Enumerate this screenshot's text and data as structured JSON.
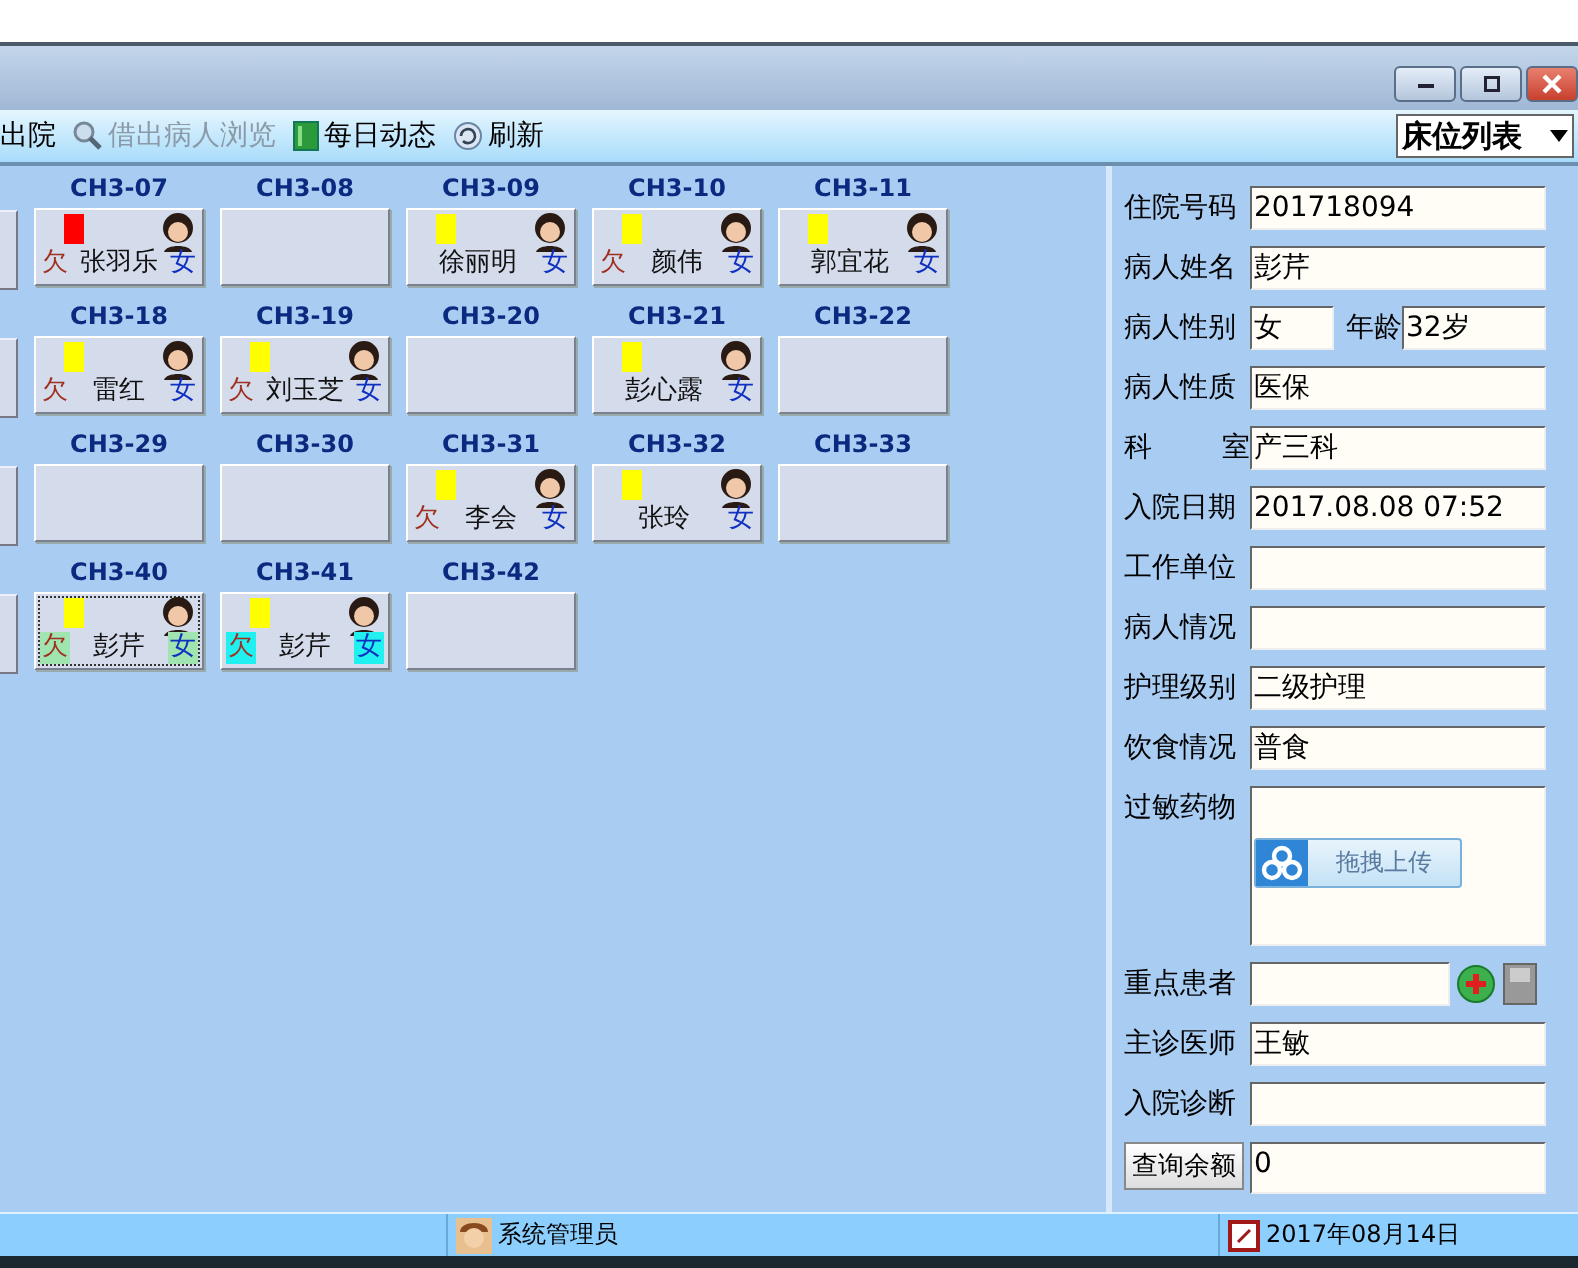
{
  "toolbar": {
    "items": [
      {
        "label": "出院",
        "disabled": false,
        "kind": "none"
      },
      {
        "label": "借出病人浏览",
        "disabled": true,
        "kind": "search"
      },
      {
        "label": "每日动态",
        "disabled": false,
        "kind": "book"
      },
      {
        "label": "刷新",
        "disabled": false,
        "kind": "refresh"
      }
    ],
    "view_select": "床位列表"
  },
  "bed_rows": [
    [
      {
        "bed": "CH3-07",
        "color": "#ff0000",
        "owing_mark": "欠",
        "name": "张羽乐",
        "sex": "女",
        "focused": false
      },
      {
        "bed": "CH3-08"
      },
      {
        "bed": "CH3-09",
        "color": "#ffff00",
        "name": "徐丽明",
        "sex": "女",
        "focused": false
      },
      {
        "bed": "CH3-10",
        "color": "#ffff00",
        "owing_mark": "欠",
        "name": "颜伟",
        "sex": "女",
        "focused": false
      },
      {
        "bed": "CH3-11",
        "color": "#ffff00",
        "name": "郭宜花",
        "sex": "女",
        "focused": false
      }
    ],
    [
      {
        "bed": "CH3-18",
        "color": "#ffff00",
        "owing_mark": "欠",
        "name": "雷红",
        "sex": "女",
        "focused": false
      },
      {
        "bed": "CH3-19",
        "color": "#ffff00",
        "owing_mark": "欠",
        "name": "刘玉芝",
        "sex": "女",
        "focused": false
      },
      {
        "bed": "CH3-20"
      },
      {
        "bed": "CH3-21",
        "color": "#ffff00",
        "name": "彭心露",
        "sex": "女",
        "focused": false
      },
      {
        "bed": "CH3-22"
      }
    ],
    [
      {
        "bed": "CH3-29"
      },
      {
        "bed": "CH3-30"
      },
      {
        "bed": "CH3-31",
        "color": "#ffff00",
        "owing_mark": "欠",
        "name": "李会",
        "sex": "女",
        "focused": false
      },
      {
        "bed": "CH3-32",
        "color": "#ffff00",
        "name": "张玲",
        "sex": "女",
        "focused": false
      },
      {
        "bed": "CH3-33"
      }
    ],
    [
      {
        "bed": "CH3-40",
        "color": "#ffff00",
        "owing_mark": "欠",
        "name": "彭芹",
        "sex": "女",
        "focused": true,
        "tag": {
          "color": "#a0e4b0"
        }
      },
      {
        "bed": "CH3-41",
        "color": "#ffff00",
        "owing_mark": "欠",
        "name": "彭芹",
        "sex": "女",
        "focused": false,
        "tag": {
          "color": "#20f0f0"
        }
      },
      {
        "bed": "CH3-42"
      }
    ]
  ],
  "form": [
    {
      "kind": "text",
      "label": "住院号码",
      "value": "201718094"
    },
    {
      "kind": "text",
      "label": "病人姓名",
      "value": "彭芹"
    },
    {
      "kind": "pair",
      "label": "病人性别",
      "value": "女",
      "label2": "年龄",
      "value2": "32岁"
    },
    {
      "kind": "text",
      "label": "病人性质",
      "value": "医保"
    },
    {
      "kind": "spread",
      "label": [
        "科",
        "室"
      ],
      "value": "产三科"
    },
    {
      "kind": "text",
      "label": "入院日期",
      "value": "2017.08.08 07:52"
    },
    {
      "kind": "text",
      "label": "工作单位"
    },
    {
      "kind": "text",
      "label": "病人情况"
    },
    {
      "kind": "text",
      "label": "护理级别",
      "value": "二级护理"
    },
    {
      "kind": "text",
      "label": "饮食情况",
      "value": "普食"
    },
    {
      "kind": "upload",
      "label": "过敏药物",
      "button": "拖拽上传"
    },
    {
      "kind": "tools",
      "label": "重点患者"
    },
    {
      "kind": "text",
      "label": "主诊医师",
      "value": "王敏"
    },
    {
      "kind": "text",
      "label": "入院诊断"
    },
    {
      "kind": "button",
      "label": "查询余额",
      "value": "0"
    }
  ],
  "status_bar": {
    "user": "系统管理员",
    "date": "2017年08月14日"
  }
}
